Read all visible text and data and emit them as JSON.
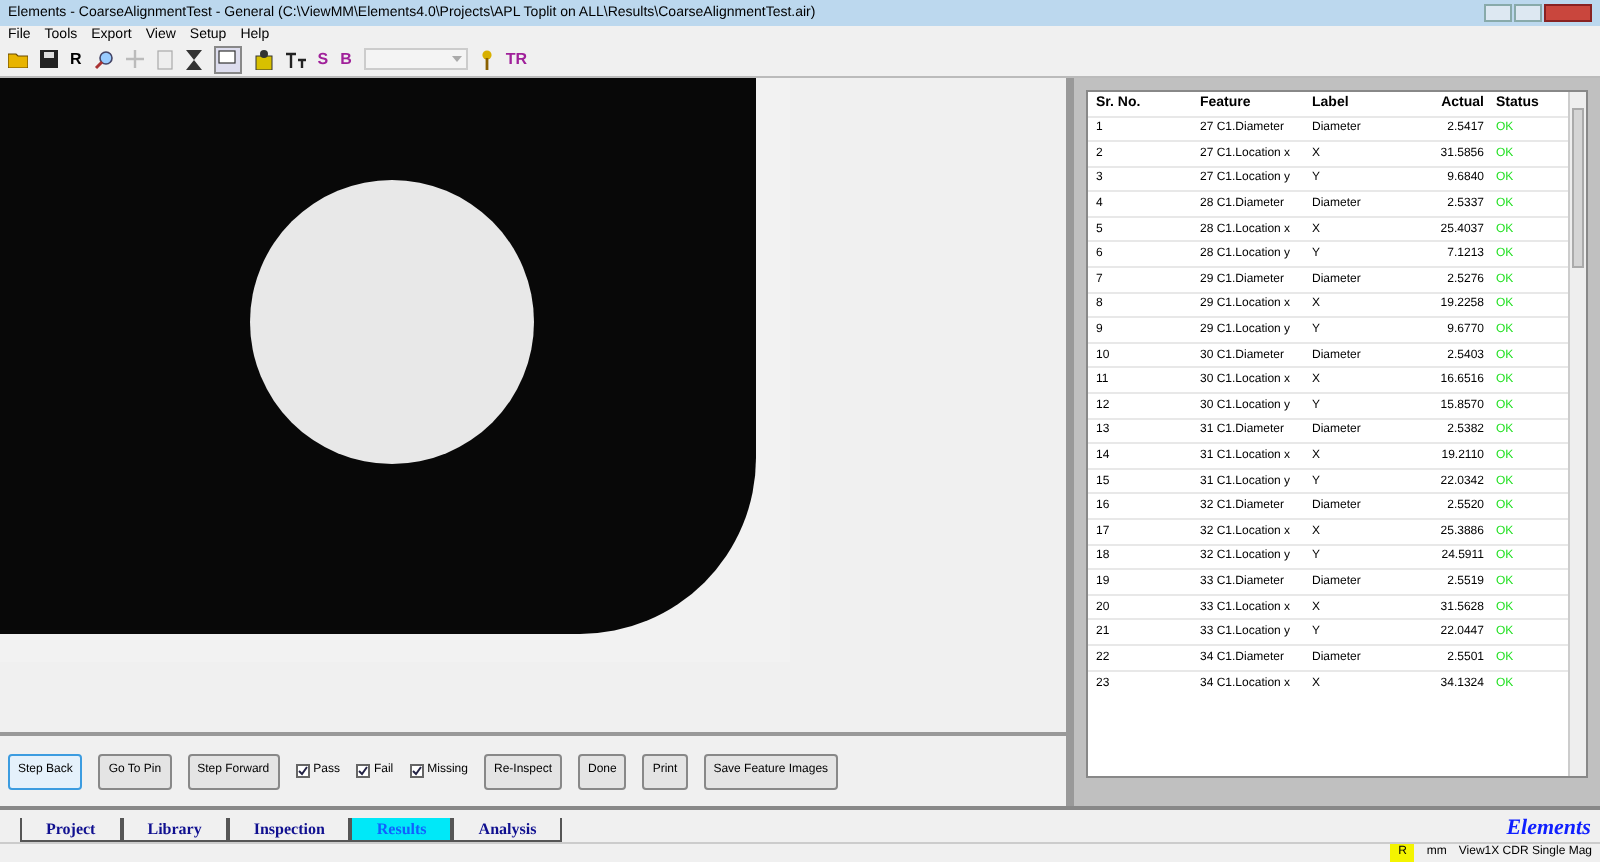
{
  "window": {
    "title": "Elements - CoarseAlignmentTest - General (C:\\ViewMM\\Elements4.0\\Projects\\APL Toplit on ALL\\Results\\CoarseAlignmentTest.air)"
  },
  "menu": [
    "File",
    "Tools",
    "Export",
    "View",
    "Setup",
    "Help"
  ],
  "toolbar": {
    "labels": [
      "R",
      "S",
      "B",
      "TR"
    ]
  },
  "table": {
    "columns": [
      "Sr. No.",
      "Feature",
      "Label",
      "Actual",
      "Status"
    ],
    "rows": [
      [
        "1",
        "27 C1.Diameter",
        "Diameter",
        "2.5417",
        "OK"
      ],
      [
        "2",
        "27 C1.Location x",
        "X",
        "31.5856",
        "OK"
      ],
      [
        "3",
        "27 C1.Location y",
        "Y",
        "9.6840",
        "OK"
      ],
      [
        "4",
        "28 C1.Diameter",
        "Diameter",
        "2.5337",
        "OK"
      ],
      [
        "5",
        "28 C1.Location x",
        "X",
        "25.4037",
        "OK"
      ],
      [
        "6",
        "28 C1.Location y",
        "Y",
        "7.1213",
        "OK"
      ],
      [
        "7",
        "29 C1.Diameter",
        "Diameter",
        "2.5276",
        "OK"
      ],
      [
        "8",
        "29 C1.Location x",
        "X",
        "19.2258",
        "OK"
      ],
      [
        "9",
        "29 C1.Location y",
        "Y",
        "9.6770",
        "OK"
      ],
      [
        "10",
        "30 C1.Diameter",
        "Diameter",
        "2.5403",
        "OK"
      ],
      [
        "11",
        "30 C1.Location x",
        "X",
        "16.6516",
        "OK"
      ],
      [
        "12",
        "30 C1.Location y",
        "Y",
        "15.8570",
        "OK"
      ],
      [
        "13",
        "31 C1.Diameter",
        "Diameter",
        "2.5382",
        "OK"
      ],
      [
        "14",
        "31 C1.Location x",
        "X",
        "19.2110",
        "OK"
      ],
      [
        "15",
        "31 C1.Location y",
        "Y",
        "22.0342",
        "OK"
      ],
      [
        "16",
        "32 C1.Diameter",
        "Diameter",
        "2.5520",
        "OK"
      ],
      [
        "17",
        "32 C1.Location x",
        "X",
        "25.3886",
        "OK"
      ],
      [
        "18",
        "32 C1.Location y",
        "Y",
        "24.5911",
        "OK"
      ],
      [
        "19",
        "33 C1.Diameter",
        "Diameter",
        "2.5519",
        "OK"
      ],
      [
        "20",
        "33 C1.Location x",
        "X",
        "31.5628",
        "OK"
      ],
      [
        "21",
        "33 C1.Location y",
        "Y",
        "22.0447",
        "OK"
      ],
      [
        "22",
        "34 C1.Diameter",
        "Diameter",
        "2.5501",
        "OK"
      ],
      [
        "23",
        "34 C1.Location x",
        "X",
        "34.1324",
        "OK"
      ]
    ]
  },
  "controls": [
    {
      "kind": "button",
      "label": "Step Back",
      "selected": true
    },
    {
      "kind": "button",
      "label": "Go To Pin",
      "selected": false
    },
    {
      "kind": "button",
      "label": "Step Forward",
      "selected": false
    },
    {
      "kind": "checkbox",
      "label": "Pass",
      "checked": true
    },
    {
      "kind": "checkbox",
      "label": "Fail",
      "checked": true
    },
    {
      "kind": "checkbox",
      "label": "Missing",
      "checked": true
    },
    {
      "kind": "button",
      "label": "Re-Inspect",
      "selected": false
    },
    {
      "kind": "button",
      "label": "Done",
      "selected": false
    },
    {
      "kind": "button",
      "label": "Print",
      "selected": false
    },
    {
      "kind": "button",
      "label": "Save Feature Images",
      "selected": false
    }
  ],
  "tabs": [
    {
      "label": "Project",
      "selected": false
    },
    {
      "label": "Library",
      "selected": false
    },
    {
      "label": "Inspection",
      "selected": false
    },
    {
      "label": "Results",
      "selected": true
    },
    {
      "label": "Analysis",
      "selected": false
    }
  ],
  "brand": "Elements",
  "status_bar": {
    "indicator": "R",
    "unit": "mm",
    "mode": "View1X CDR Single Mag"
  }
}
